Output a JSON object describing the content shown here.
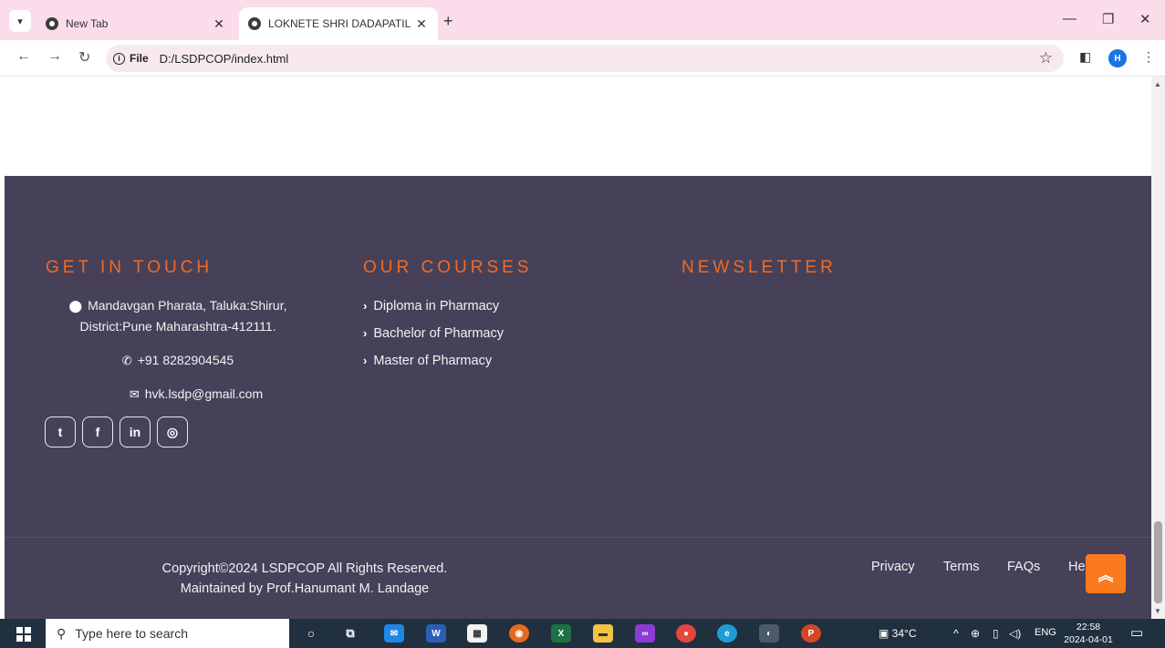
{
  "browser": {
    "tabs": [
      {
        "title": "New Tab",
        "active": false
      },
      {
        "title": "LOKNETE SHRI DADAPATIL PHA",
        "active": true
      }
    ],
    "file_chip": "File",
    "url": "D:/LSDPCOP/index.html",
    "profile_initial": "H"
  },
  "footer": {
    "contact": {
      "title": "GET IN TOUCH",
      "address_line1": "Mandavgan Pharata, Taluka:Shirur,",
      "address_line2": "District:Pune Maharashtra-412111.",
      "phone": "+91 8282904545",
      "email": "hvk.lsdp@gmail.com",
      "social": [
        {
          "icon": "twitter-icon",
          "glyph": "t"
        },
        {
          "icon": "facebook-icon",
          "glyph": "f"
        },
        {
          "icon": "linkedin-icon",
          "glyph": "in"
        },
        {
          "icon": "instagram-icon",
          "glyph": "◎"
        }
      ]
    },
    "courses": {
      "title": "OUR COURSES",
      "items": [
        "Diploma in Pharmacy",
        "Bachelor of Pharmacy",
        "Master of Pharmacy"
      ]
    },
    "newsletter": {
      "title": "NEWSLETTER"
    },
    "copyright_line1": "Copyright©2024 LSDPCOP All Rights Reserved.",
    "copyright_line2": "Maintained by Prof.Hanumant M. Landage",
    "links": [
      "Privacy",
      "Terms",
      "FAQs",
      "He"
    ]
  },
  "taskbar": {
    "search_placeholder": "Type here to search",
    "temperature": "34°C",
    "language": "ENG",
    "time": "22:58",
    "date": "2024-04-01"
  },
  "colors": {
    "footer_bg": "#464159",
    "accent": "#f26a22",
    "back_to_top": "#fb7a1e",
    "tab_strip": "#fbdcea"
  }
}
